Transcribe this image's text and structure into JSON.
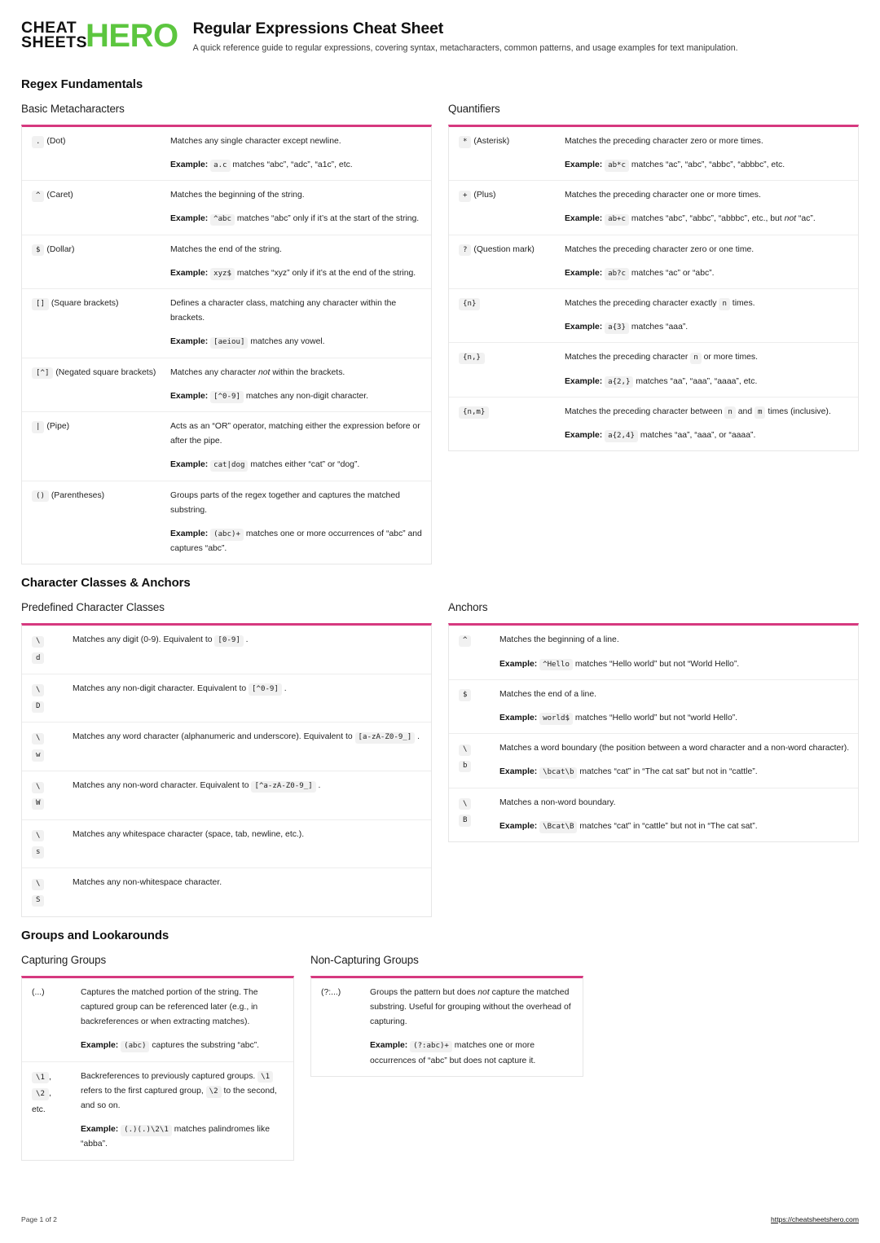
{
  "brand": {
    "logo_line1": "CHEAT",
    "logo_line2": "SHEETS",
    "logo_hero": "HERO",
    "green": "#5cc63f",
    "accent": "#d6397f"
  },
  "header": {
    "title": "Regular Expressions Cheat Sheet",
    "subtitle": "A quick reference guide to regular expressions, covering syntax, metacharacters, common patterns, and usage examples for text manipulation."
  },
  "sections": [
    {
      "title": "Regex Fundamentals"
    },
    {
      "title": "Character Classes & Anchors"
    },
    {
      "title": "Groups and Lookarounds"
    }
  ],
  "tables": {
    "basic_metacharacters": {
      "title": "Basic Metacharacters",
      "rows": [
        {
          "code": ".",
          "name": "(Dot)",
          "desc": "Matches any single character except newline.",
          "example_code": "a.c",
          "example_text": "matches “abc”, “adc”, “a1c”, etc."
        },
        {
          "code": "^",
          "name": "(Caret)",
          "desc": "Matches the beginning of the string.",
          "example_code": "^abc",
          "example_text": "matches “abc” only if it’s at the start of the string."
        },
        {
          "code": "$",
          "name": "(Dollar)",
          "desc": "Matches the end of the string.",
          "example_code": "xyz$",
          "example_text": "matches “xyz” only if it’s at the end of the string."
        },
        {
          "code": "[]",
          "name": "(Square brackets)",
          "desc": "Defines a character class, matching any character within the brackets.",
          "example_code": "[aeiou]",
          "example_text": "matches any vowel."
        },
        {
          "code": "[^]",
          "name": "(Negated square brackets)",
          "desc_pre": "Matches any character ",
          "desc_em": "not",
          "desc_post": " within the brackets.",
          "example_code": "[^0-9]",
          "example_text": "matches any non-digit character."
        },
        {
          "code": "|",
          "name": "(Pipe)",
          "desc": "Acts as an “OR” operator, matching either the expression before or after the pipe.",
          "example_code": "cat|dog",
          "example_text": "matches either “cat” or “dog”."
        },
        {
          "code": "()",
          "name": "(Parentheses)",
          "desc": "Groups parts of the regex together and captures the matched substring.",
          "example_code": "(abc)+",
          "example_text": "matches one or more occurrences of “abc” and captures “abc”."
        }
      ]
    },
    "quantifiers": {
      "title": "Quantifiers",
      "rows": [
        {
          "code": "*",
          "name": "(Asterisk)",
          "desc": "Matches the preceding character zero or more times.",
          "example_code": "ab*c",
          "example_text": "matches “ac”, “abc”, “abbc”, “abbbc”, etc."
        },
        {
          "code": "+",
          "name": "(Plus)",
          "desc": "Matches the preceding character one or more times.",
          "example_code": "ab+c",
          "example_pre": "matches “abc”, “abbc”, “abbbc”, etc., but ",
          "example_em": "not",
          "example_post": " “ac”."
        },
        {
          "code": "?",
          "name": "(Question mark)",
          "desc": "Matches the preceding character zero or one time.",
          "example_code": "ab?c",
          "example_text": "matches “ac” or “abc”."
        },
        {
          "code": "{n}",
          "name": "",
          "desc_pre": "Matches the preceding character exactly ",
          "desc_inline_code": "n",
          "desc_post": " times.",
          "example_code": "a{3}",
          "example_text": "matches “aaa”."
        },
        {
          "code": "{n,}",
          "name": "",
          "desc_pre": "Matches the preceding character ",
          "desc_inline_code": "n",
          "desc_post": " or more times.",
          "example_code": "a{2,}",
          "example_text": "matches “aa”, “aaa”, “aaaa”, etc."
        },
        {
          "code": "{n,m}",
          "name": "",
          "desc_pre": "Matches the preceding character between ",
          "desc_inline_code": "n",
          "desc_mid": " and ",
          "desc_inline_code2": "m",
          "desc_post": " times (inclusive).",
          "example_code": "a{2,4}",
          "example_text": "matches “aa”, “aaa”, or “aaaa”."
        }
      ]
    },
    "predefined_classes": {
      "title": "Predefined Character Classes",
      "rows": [
        {
          "code_slash": "\\",
          "code_letter": "d",
          "desc_pre": "Matches any digit (0-9). Equivalent to ",
          "desc_inline_code": "[0-9]",
          "desc_post": " ."
        },
        {
          "code_slash": "\\",
          "code_letter": "D",
          "desc_pre": "Matches any non-digit character. Equivalent to ",
          "desc_inline_code": "[^0-9]",
          "desc_post": " ."
        },
        {
          "code_slash": "\\",
          "code_letter": "w",
          "desc_pre": "Matches any word character (alphanumeric and underscore). Equivalent to ",
          "desc_inline_code": "[a-zA-Z0-9_]",
          "desc_post": " ."
        },
        {
          "code_slash": "\\",
          "code_letter": "W",
          "desc_pre": "Matches any non-word character. Equivalent to ",
          "desc_inline_code": "[^a-zA-Z0-9_]",
          "desc_post": " ."
        },
        {
          "code_slash": "\\",
          "code_letter": "s",
          "desc_pre": "Matches any whitespace character (space, tab, newline, etc.).",
          "desc_inline_code": "",
          "desc_post": ""
        },
        {
          "code_slash": "\\",
          "code_letter": "S",
          "desc_pre": "Matches any non-whitespace character.",
          "desc_inline_code": "",
          "desc_post": ""
        }
      ]
    },
    "anchors": {
      "title": "Anchors",
      "rows": [
        {
          "code": "^",
          "desc": "Matches the beginning of a line.",
          "example_code": "^Hello",
          "example_text": "matches “Hello world” but not “World Hello”."
        },
        {
          "code": "$",
          "desc": "Matches the end of a line.",
          "example_code": "world$",
          "example_text": "matches “Hello world” but not “world Hello”."
        },
        {
          "code_slash": "\\",
          "code_letter": "b",
          "desc": "Matches a word boundary (the position between a word character and a non-word character).",
          "example_code": "\\bcat\\b",
          "example_text": "matches “cat” in “The cat sat” but not in “cattle”."
        },
        {
          "code_slash": "\\",
          "code_letter": "B",
          "desc": "Matches a non-word boundary.",
          "example_code": "\\Bcat\\B",
          "example_text": "matches “cat” in “cattle” but not in “The cat sat”."
        }
      ]
    },
    "capturing_groups": {
      "title": "Capturing Groups",
      "rows": [
        {
          "key_plain": "(...)",
          "desc": "Captures the matched portion of the string. The captured group can be referenced later (e.g., in backreferences or when extracting matches).",
          "example_code": "(abc)",
          "example_text": "captures the substring “abc”."
        },
        {
          "key_code1": "\\1",
          "key_sep1": ",",
          "key_code2": "\\2",
          "key_sep2": ",",
          "key_tail": "etc.",
          "desc_pre": "Backreferences to previously captured groups. ",
          "desc_inline_code": "\\1",
          "desc_mid": " refers to the first captured group, ",
          "desc_inline_code2": "\\2",
          "desc_post": " to the second, and so on.",
          "example_code": "(.)(.)\\2\\1",
          "example_text": "matches palindromes like “abba”."
        }
      ]
    },
    "non_capturing_groups": {
      "title": "Non-Capturing Groups",
      "rows": [
        {
          "key_plain": "(?:...)",
          "desc_pre": "Groups the pattern but does ",
          "desc_em": "not",
          "desc_post": " capture the matched substring. Useful for grouping without the overhead of capturing.",
          "example_code": "(?:abc)+",
          "example_text": "matches one or more occurrences of “abc” but does not capture it."
        }
      ]
    }
  },
  "labels": {
    "example": "Example:"
  },
  "footer": {
    "page": "Page 1 of 2",
    "url": "https://cheatsheetshero.com"
  }
}
